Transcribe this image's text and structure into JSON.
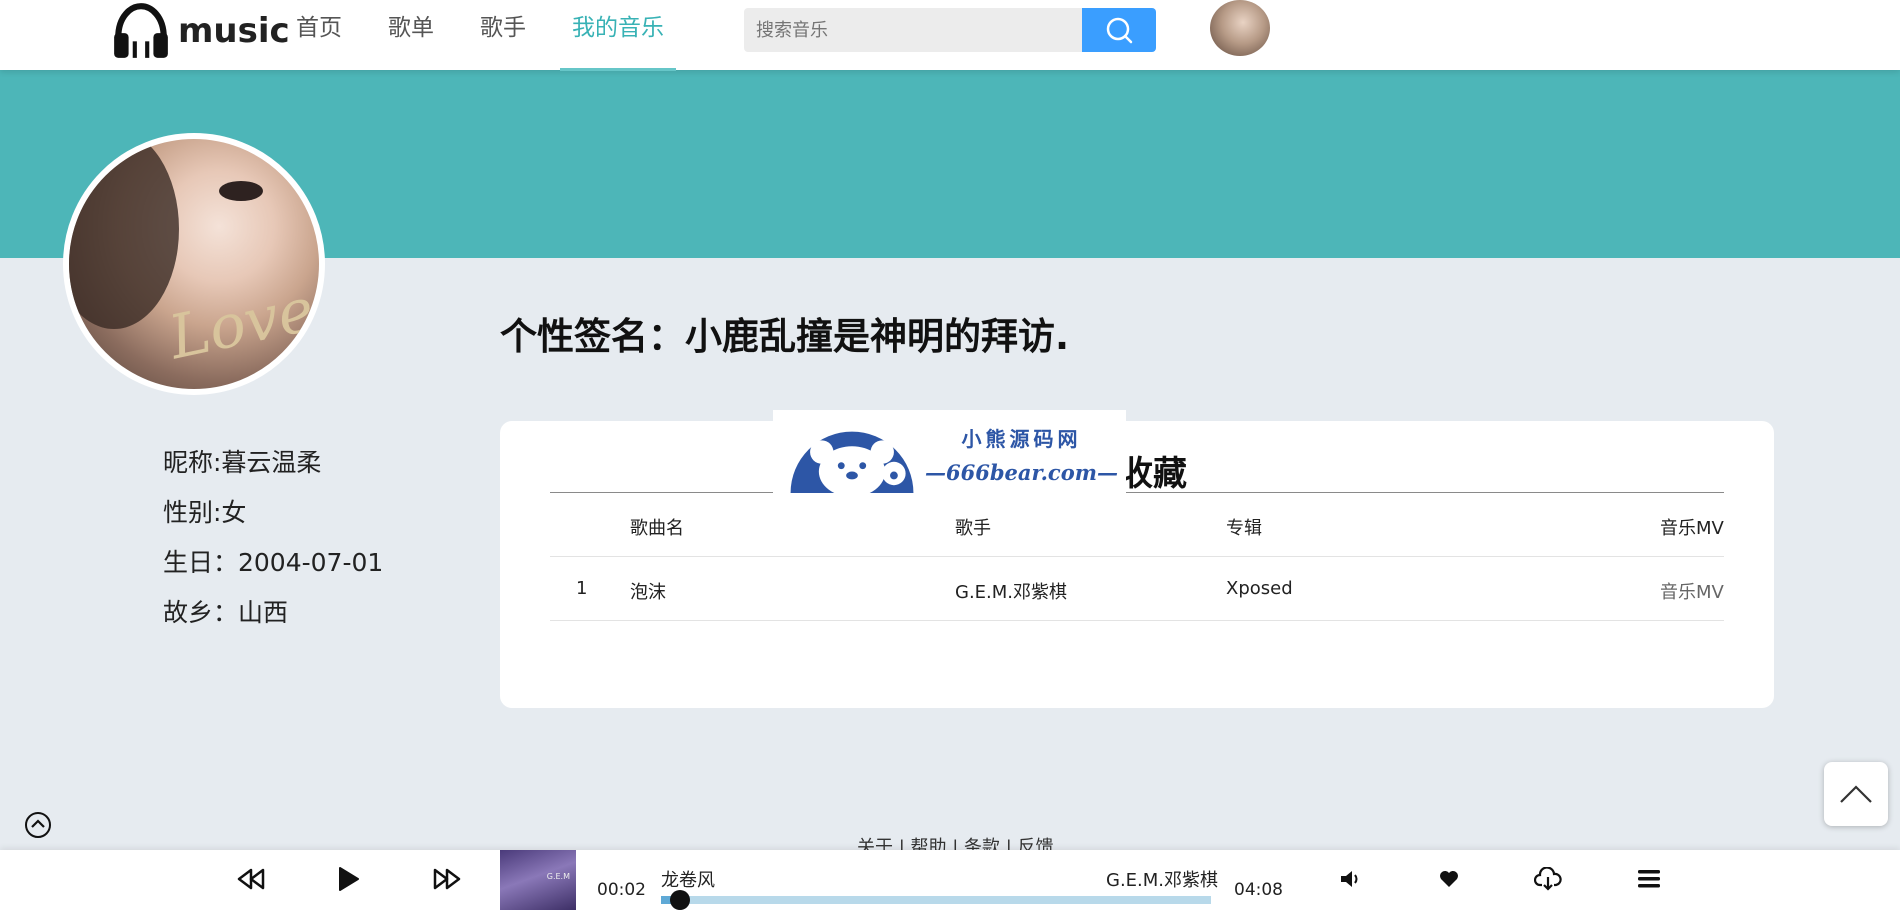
{
  "header": {
    "logo_text": "music",
    "nav": [
      {
        "label": "首页",
        "active": false
      },
      {
        "label": "歌单",
        "active": false
      },
      {
        "label": "歌手",
        "active": false
      },
      {
        "label": "我的音乐",
        "active": true
      }
    ],
    "search_placeholder": "搜索音乐",
    "accent_color": "#4db6b8",
    "search_button_color": "#3a9eff"
  },
  "profile": {
    "signature": "个性签名：小鹿乱撞是神明的拜访.",
    "nickname": "昵称:暮云温柔",
    "gender": "性别:女",
    "birthday": "生日：2004-07-01",
    "hometown": "故乡：山西"
  },
  "collection": {
    "title": "的收藏",
    "columns": [
      "歌曲名",
      "歌手",
      "专辑",
      "音乐MV"
    ],
    "rows": [
      {
        "index": "1",
        "song": "泡沫",
        "singer": "G.E.M.邓紫棋",
        "album": "Xposed",
        "mv": "音乐MV"
      }
    ]
  },
  "watermark": {
    "cn": "小熊源码网",
    "url": "—666bear.com—"
  },
  "footer": {
    "links": "关于 | 帮助 | 条款 | 反馈"
  },
  "player": {
    "current_time": "00:02",
    "total_time": "04:08",
    "song": "龙卷风",
    "singer": "G.E.M.邓紫棋",
    "progress_fraction": 0.02,
    "cover_text": "G.E.M"
  }
}
